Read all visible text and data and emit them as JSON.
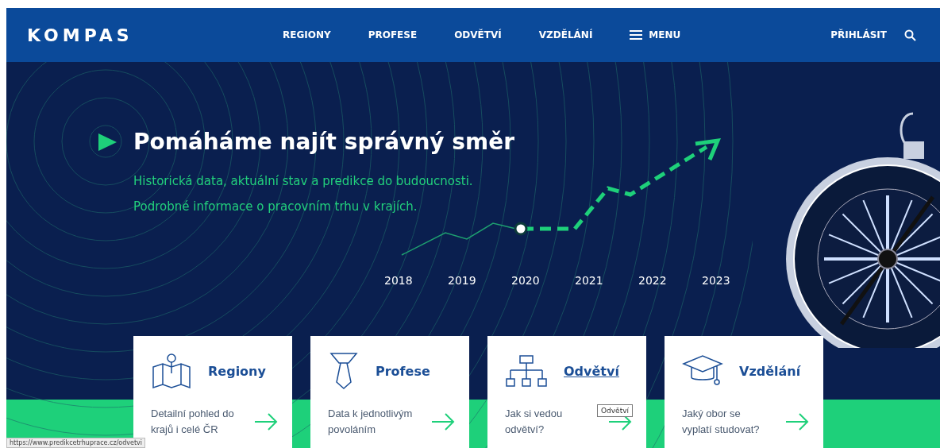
{
  "header": {
    "logo": "KOMPAS",
    "nav": [
      "REGIONY",
      "PROFESE",
      "ODVĚTVÍ",
      "VZDĚLÁNÍ"
    ],
    "menu": "MENU",
    "login": "PŘIHLÁSIT"
  },
  "hero": {
    "title": "Pomáháme najít správný směr",
    "subtitles": [
      "Historická data, aktuální stav a predikce do budoucnosti.",
      "Podrobné informace o pracovním trhu v krajích."
    ],
    "years": [
      "2018",
      "2019",
      "2020",
      "2021",
      "2022",
      "2023"
    ]
  },
  "cards": [
    {
      "kind": "map",
      "title": "Regiony",
      "text": "Detailní pohled do krajů i celé ČR",
      "hovered": false
    },
    {
      "kind": "tie",
      "title": "Profese",
      "text": "Data k jednotlivým povoláním",
      "hovered": false
    },
    {
      "kind": "org",
      "title": "Odvětví",
      "text": "Jak si vedou odvětví?",
      "hovered": true,
      "tooltip": "Odvětví"
    },
    {
      "kind": "cap",
      "title": "Vzdělání",
      "text": "Jaký obor se vyplatí studovat?",
      "hovered": false
    }
  ],
  "status_bar": "https://www.predikcetrhuprace.cz/odvetvi"
}
